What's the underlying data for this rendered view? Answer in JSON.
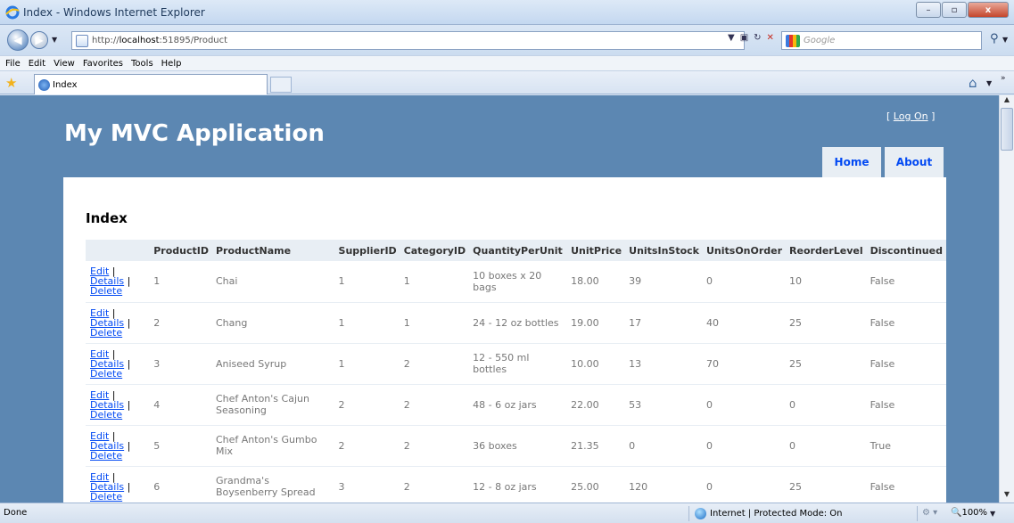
{
  "window": {
    "title": "Index - Windows Internet Explorer",
    "minimize_label": "–",
    "maximize_label": "▫",
    "close_label": "x"
  },
  "address": {
    "url_prefix": "http://",
    "url_host": "localhost",
    "url_rest": ":51895/Product",
    "search_placeholder": "Google"
  },
  "menu": [
    "File",
    "Edit",
    "View",
    "Favorites",
    "Tools",
    "Help"
  ],
  "tab": {
    "label": "Index"
  },
  "site": {
    "title": "My MVC Application",
    "logon_open": "[ ",
    "logon_link": "Log On",
    "logon_close": " ]",
    "nav": {
      "home": "Home",
      "about": "About"
    }
  },
  "page": {
    "heading": "Index",
    "columns": [
      "",
      "ProductID",
      "ProductName",
      "SupplierID",
      "CategoryID",
      "QuantityPerUnit",
      "UnitPrice",
      "UnitsInStock",
      "UnitsOnOrder",
      "ReorderLevel",
      "Discontinued"
    ],
    "action_labels": {
      "edit": "Edit",
      "details": "Details",
      "delete": "Delete",
      "sep": " |"
    },
    "rows": [
      {
        "id": "1",
        "name": "Chai",
        "supplier": "1",
        "category": "1",
        "qty": "10 boxes x 20 bags",
        "price": "18.00",
        "stock": "39",
        "order": "0",
        "reorder": "10",
        "disc": "False"
      },
      {
        "id": "2",
        "name": "Chang",
        "supplier": "1",
        "category": "1",
        "qty": "24 - 12 oz bottles",
        "price": "19.00",
        "stock": "17",
        "order": "40",
        "reorder": "25",
        "disc": "False"
      },
      {
        "id": "3",
        "name": "Aniseed Syrup",
        "supplier": "1",
        "category": "2",
        "qty": "12 - 550 ml bottles",
        "price": "10.00",
        "stock": "13",
        "order": "70",
        "reorder": "25",
        "disc": "False"
      },
      {
        "id": "4",
        "name": "Chef Anton's Cajun Seasoning",
        "supplier": "2",
        "category": "2",
        "qty": "48 - 6 oz jars",
        "price": "22.00",
        "stock": "53",
        "order": "0",
        "reorder": "0",
        "disc": "False"
      },
      {
        "id": "5",
        "name": "Chef Anton's Gumbo Mix",
        "supplier": "2",
        "category": "2",
        "qty": "36 boxes",
        "price": "21.35",
        "stock": "0",
        "order": "0",
        "reorder": "0",
        "disc": "True"
      },
      {
        "id": "6",
        "name": "Grandma's Boysenberry Spread",
        "supplier": "3",
        "category": "2",
        "qty": "12 - 8 oz jars",
        "price": "25.00",
        "stock": "120",
        "order": "0",
        "reorder": "25",
        "disc": "False"
      }
    ]
  },
  "status": {
    "done": "Done",
    "zone": "Internet | Protected Mode: On",
    "zoom": "100%"
  }
}
